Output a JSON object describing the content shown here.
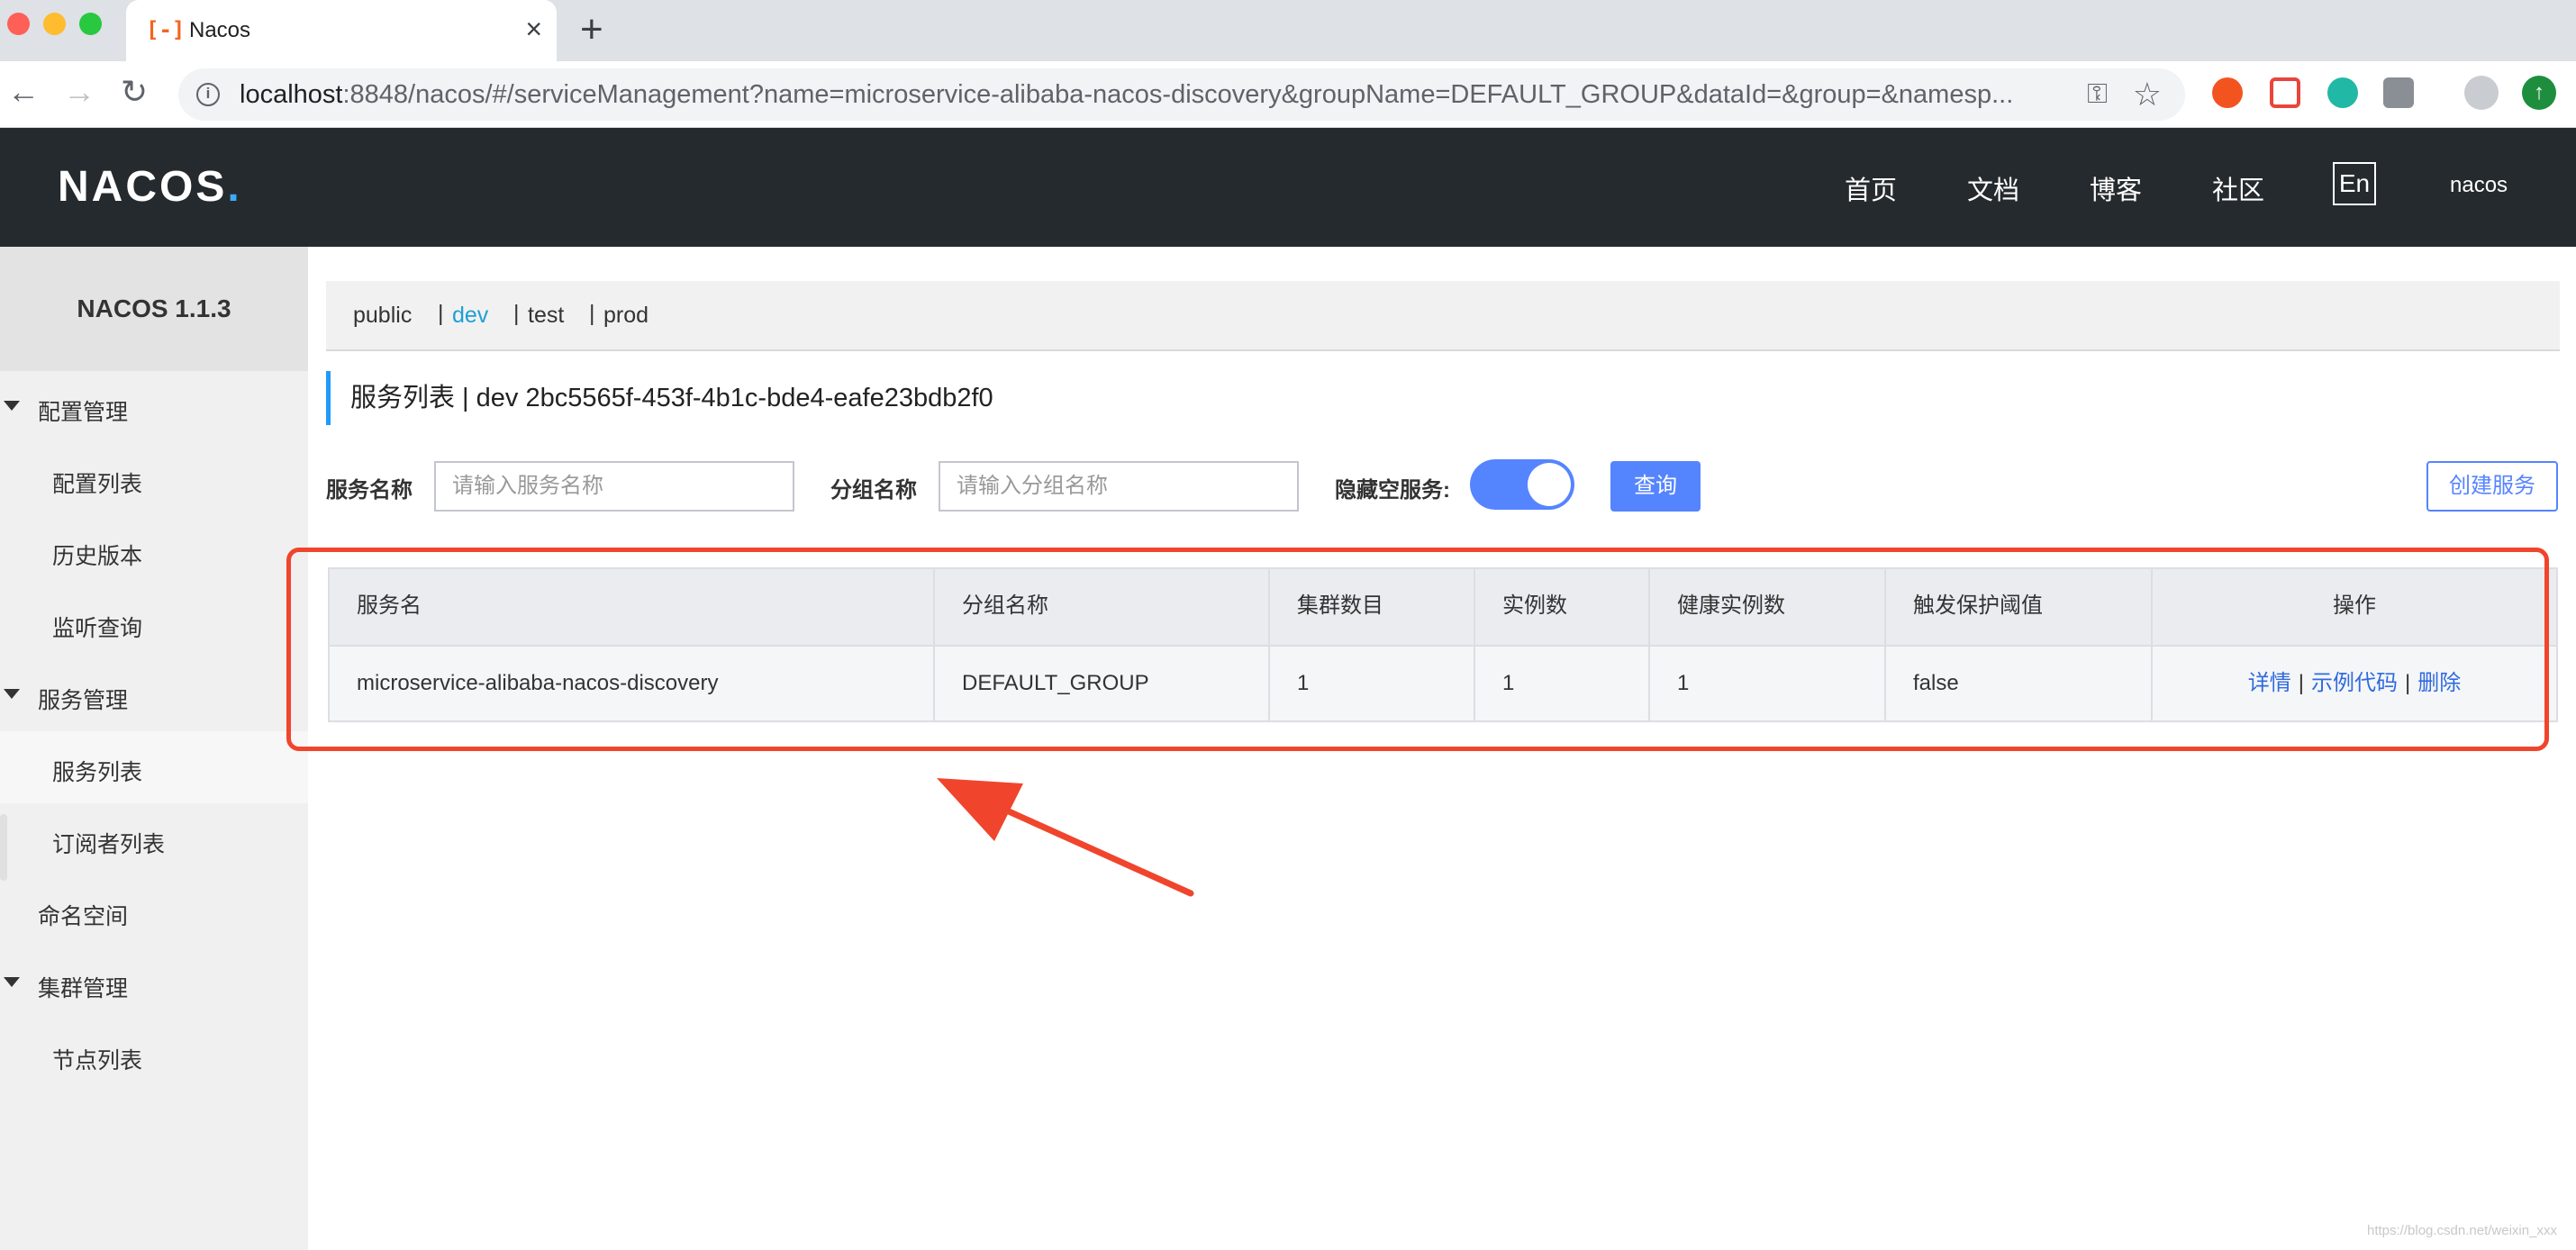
{
  "browser": {
    "tab_title": "Nacos",
    "tab_close": "×",
    "new_tab": "+",
    "url_host": "localhost",
    "url_rest": ":8848/nacos/#/serviceManagement?name=microservice-alibaba-nacos-discovery&groupName=DEFAULT_GROUP&dataId=&group=&namesp...",
    "back": "←",
    "forward": "→",
    "reload": "↻"
  },
  "header": {
    "logo": "NACOS",
    "nav": [
      "首页",
      "文档",
      "博客",
      "社区"
    ],
    "lang": "En",
    "user": "nacos"
  },
  "sidebar": {
    "version": "NACOS 1.1.3",
    "groups": [
      {
        "label": "配置管理",
        "items": [
          "配置列表",
          "历史版本",
          "监听查询"
        ]
      },
      {
        "label": "服务管理",
        "items": [
          "服务列表",
          "订阅者列表"
        ]
      },
      {
        "label": "命名空间",
        "items": []
      },
      {
        "label": "集群管理",
        "items": [
          "节点列表"
        ]
      }
    ]
  },
  "namespaces": {
    "items": [
      "public",
      "dev",
      "test",
      "prod"
    ],
    "selected": "dev",
    "separator": "|"
  },
  "page": {
    "title": "服务列表  |  dev  2bc5565f-453f-4b1c-bde4-eafe23bdb2f0"
  },
  "filters": {
    "service_label": "服务名称",
    "service_placeholder": "请输入服务名称",
    "group_label": "分组名称",
    "group_placeholder": "请输入分组名称",
    "hide_empty_label": "隐藏空服务:",
    "hide_empty_on": true,
    "query_button": "查询",
    "create_button": "创建服务"
  },
  "table": {
    "columns": [
      "服务名",
      "分组名称",
      "集群数目",
      "实例数",
      "健康实例数",
      "触发保护阈值",
      "操作"
    ],
    "rows": [
      {
        "service": "microservice-alibaba-nacos-discovery",
        "group": "DEFAULT_GROUP",
        "clusters": "1",
        "instances": "1",
        "healthy": "1",
        "threshold": "false",
        "actions": [
          "详情",
          "示例代码",
          "删除"
        ]
      }
    ]
  },
  "watermark": "https://blog.csdn.net/weixin_xxx",
  "colors": {
    "accent": "#5584ff",
    "header_bg": "#252a2f",
    "annotation": "#f0452c",
    "link": "#2f6ae1"
  }
}
